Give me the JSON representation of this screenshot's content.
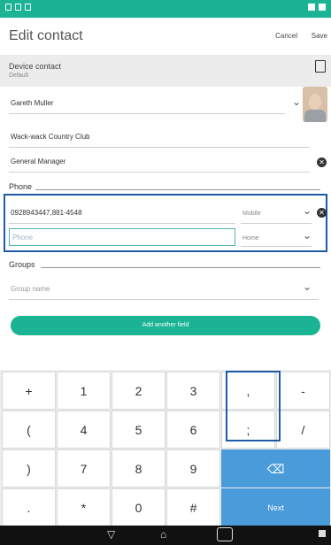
{
  "header": {
    "title": "Edit contact",
    "cancel_label": "Cancel",
    "save_label": "Save"
  },
  "account": {
    "title": "Device contact",
    "subtitle": "Default"
  },
  "contact": {
    "name": "Gareth Muller",
    "company": "Wack-wack Country Club",
    "job_title": "General Manager"
  },
  "phone": {
    "section_label": "Phone",
    "entries": [
      {
        "value": "0928943447,881-4548",
        "type": "Mobile"
      },
      {
        "value": "",
        "placeholder": "Phone",
        "type": "Home"
      }
    ]
  },
  "groups": {
    "section_label": "Groups",
    "placeholder": "Group name"
  },
  "add_field_label": "Add another field",
  "keyboard": {
    "rows": [
      [
        "+",
        "1",
        "2",
        "3",
        ",",
        "-"
      ],
      [
        "(",
        "4",
        "5",
        "6",
        ";",
        "/"
      ],
      [
        ")",
        "7",
        "8",
        "9",
        "",
        ""
      ],
      [
        ".",
        "*",
        "0",
        "#",
        "",
        ""
      ]
    ],
    "next_label": "Next",
    "backspace_icon": "backspace-icon"
  },
  "nav": {
    "back_icon": "back-icon",
    "home_icon": "home-icon",
    "recents_icon": "recents-icon"
  },
  "colors": {
    "accent": "#1ab394",
    "key_blue": "#4a9bd9",
    "highlight": "#1e5aa8"
  }
}
